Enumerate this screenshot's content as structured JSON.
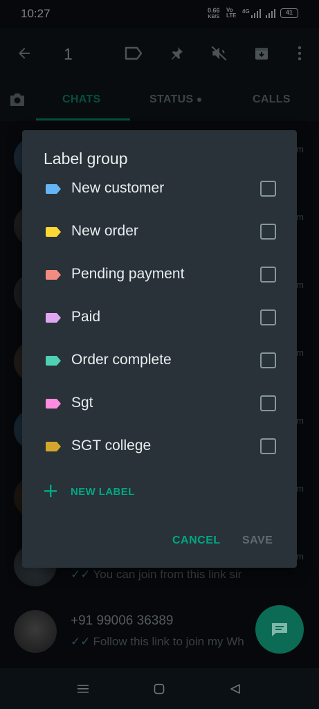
{
  "status_bar": {
    "time": "10:27",
    "speed_value": "0.66",
    "speed_unit": "KB/S",
    "volte": "Vo LTE",
    "volte_line1": "Vo",
    "volte_line2": "LTE",
    "network": "4G",
    "battery": "41"
  },
  "action_bar": {
    "selected_count": "1",
    "icons": [
      "back-arrow-icon",
      "label-icon",
      "pin-icon",
      "mute-icon",
      "archive-icon",
      "more-vert-icon"
    ]
  },
  "tabs": [
    {
      "label": "CHATS",
      "active": true
    },
    {
      "label": "STATUS",
      "active": false
    },
    {
      "label": "CALLS",
      "active": false
    }
  ],
  "background_chats": [
    {
      "time": "m",
      "title": "",
      "preview": ""
    },
    {
      "time": "m",
      "title": "",
      "preview": ""
    },
    {
      "time": "m",
      "title": "",
      "preview": ""
    },
    {
      "time": "m",
      "title": "",
      "preview": ""
    },
    {
      "time": "m",
      "title": "",
      "preview": ""
    },
    {
      "time": "m",
      "title": "",
      "preview": ""
    },
    {
      "time": "m",
      "title": "",
      "preview": "You can join from this link sir"
    },
    {
      "time": "",
      "title": "+91 99006 36389",
      "preview": "Follow this link to join my Wh"
    }
  ],
  "dialog": {
    "title": "Label group",
    "labels": [
      {
        "name": "New customer",
        "color": "#64b5f6",
        "checked": false
      },
      {
        "name": "New order",
        "color": "#fdd835",
        "checked": false
      },
      {
        "name": "Pending payment",
        "color": "#f28b82",
        "checked": false
      },
      {
        "name": "Paid",
        "color": "#e1a6f0",
        "checked": false
      },
      {
        "name": "Order complete",
        "color": "#4dd0b4",
        "checked": false
      },
      {
        "name": "Sgt",
        "color": "#ff8ce0",
        "checked": false
      },
      {
        "name": "SGT college",
        "color": "#d4a72c",
        "checked": false
      }
    ],
    "new_label": "NEW LABEL",
    "cancel": "CANCEL",
    "save": "SAVE"
  },
  "colors": {
    "accent": "#00a884",
    "dialog_bg": "#283238",
    "app_bg": "#0b1014"
  }
}
